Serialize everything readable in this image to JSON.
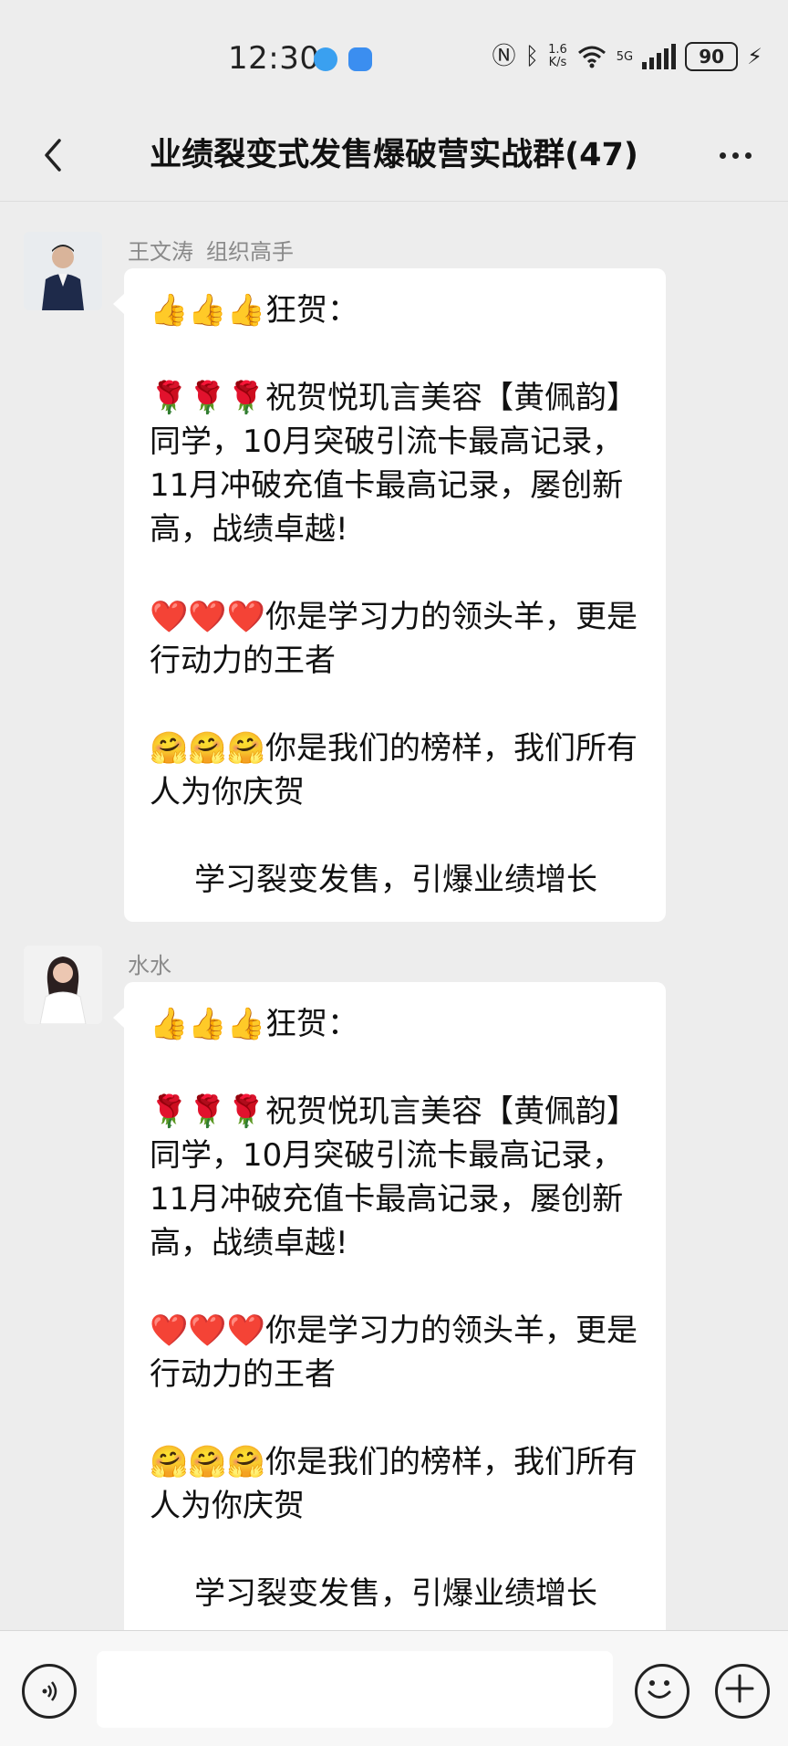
{
  "status_bar": {
    "time": "12:30",
    "net_speed_top": "1.6",
    "net_speed_bottom": "K/s",
    "network": "5G",
    "battery": "90"
  },
  "header": {
    "title": "业绩裂变式发售爆破营实战群(47)"
  },
  "messages": [
    {
      "sender": "王文涛",
      "role": "组织高手",
      "lines": [
        "👍👍👍狂贺：",
        "🌹🌹🌹祝贺悦玑言美容【黄佩韵】同学，10月突破引流卡最高记录，11月冲破充值卡最高记录，屡创新高，战绩卓越!",
        "❤️❤️❤️你是学习力的领头羊，更是行动力的王者",
        "🤗🤗🤗你是我们的榜样，我们所有人为你庆贺",
        "学习裂变发售，引爆业绩增长"
      ]
    },
    {
      "sender": "水水",
      "role": "",
      "lines": [
        "👍👍👍狂贺：",
        "🌹🌹🌹祝贺悦玑言美容【黄佩韵】同学，10月突破引流卡最高记录，11月冲破充值卡最高记录，屡创新高，战绩卓越!",
        "❤️❤️❤️你是学习力的领头羊，更是行动力的王者",
        "🤗🤗🤗你是我们的榜样，我们所有人为你庆贺",
        "学习裂变发售，引爆业绩增长"
      ]
    }
  ],
  "input": {
    "placeholder": ""
  }
}
